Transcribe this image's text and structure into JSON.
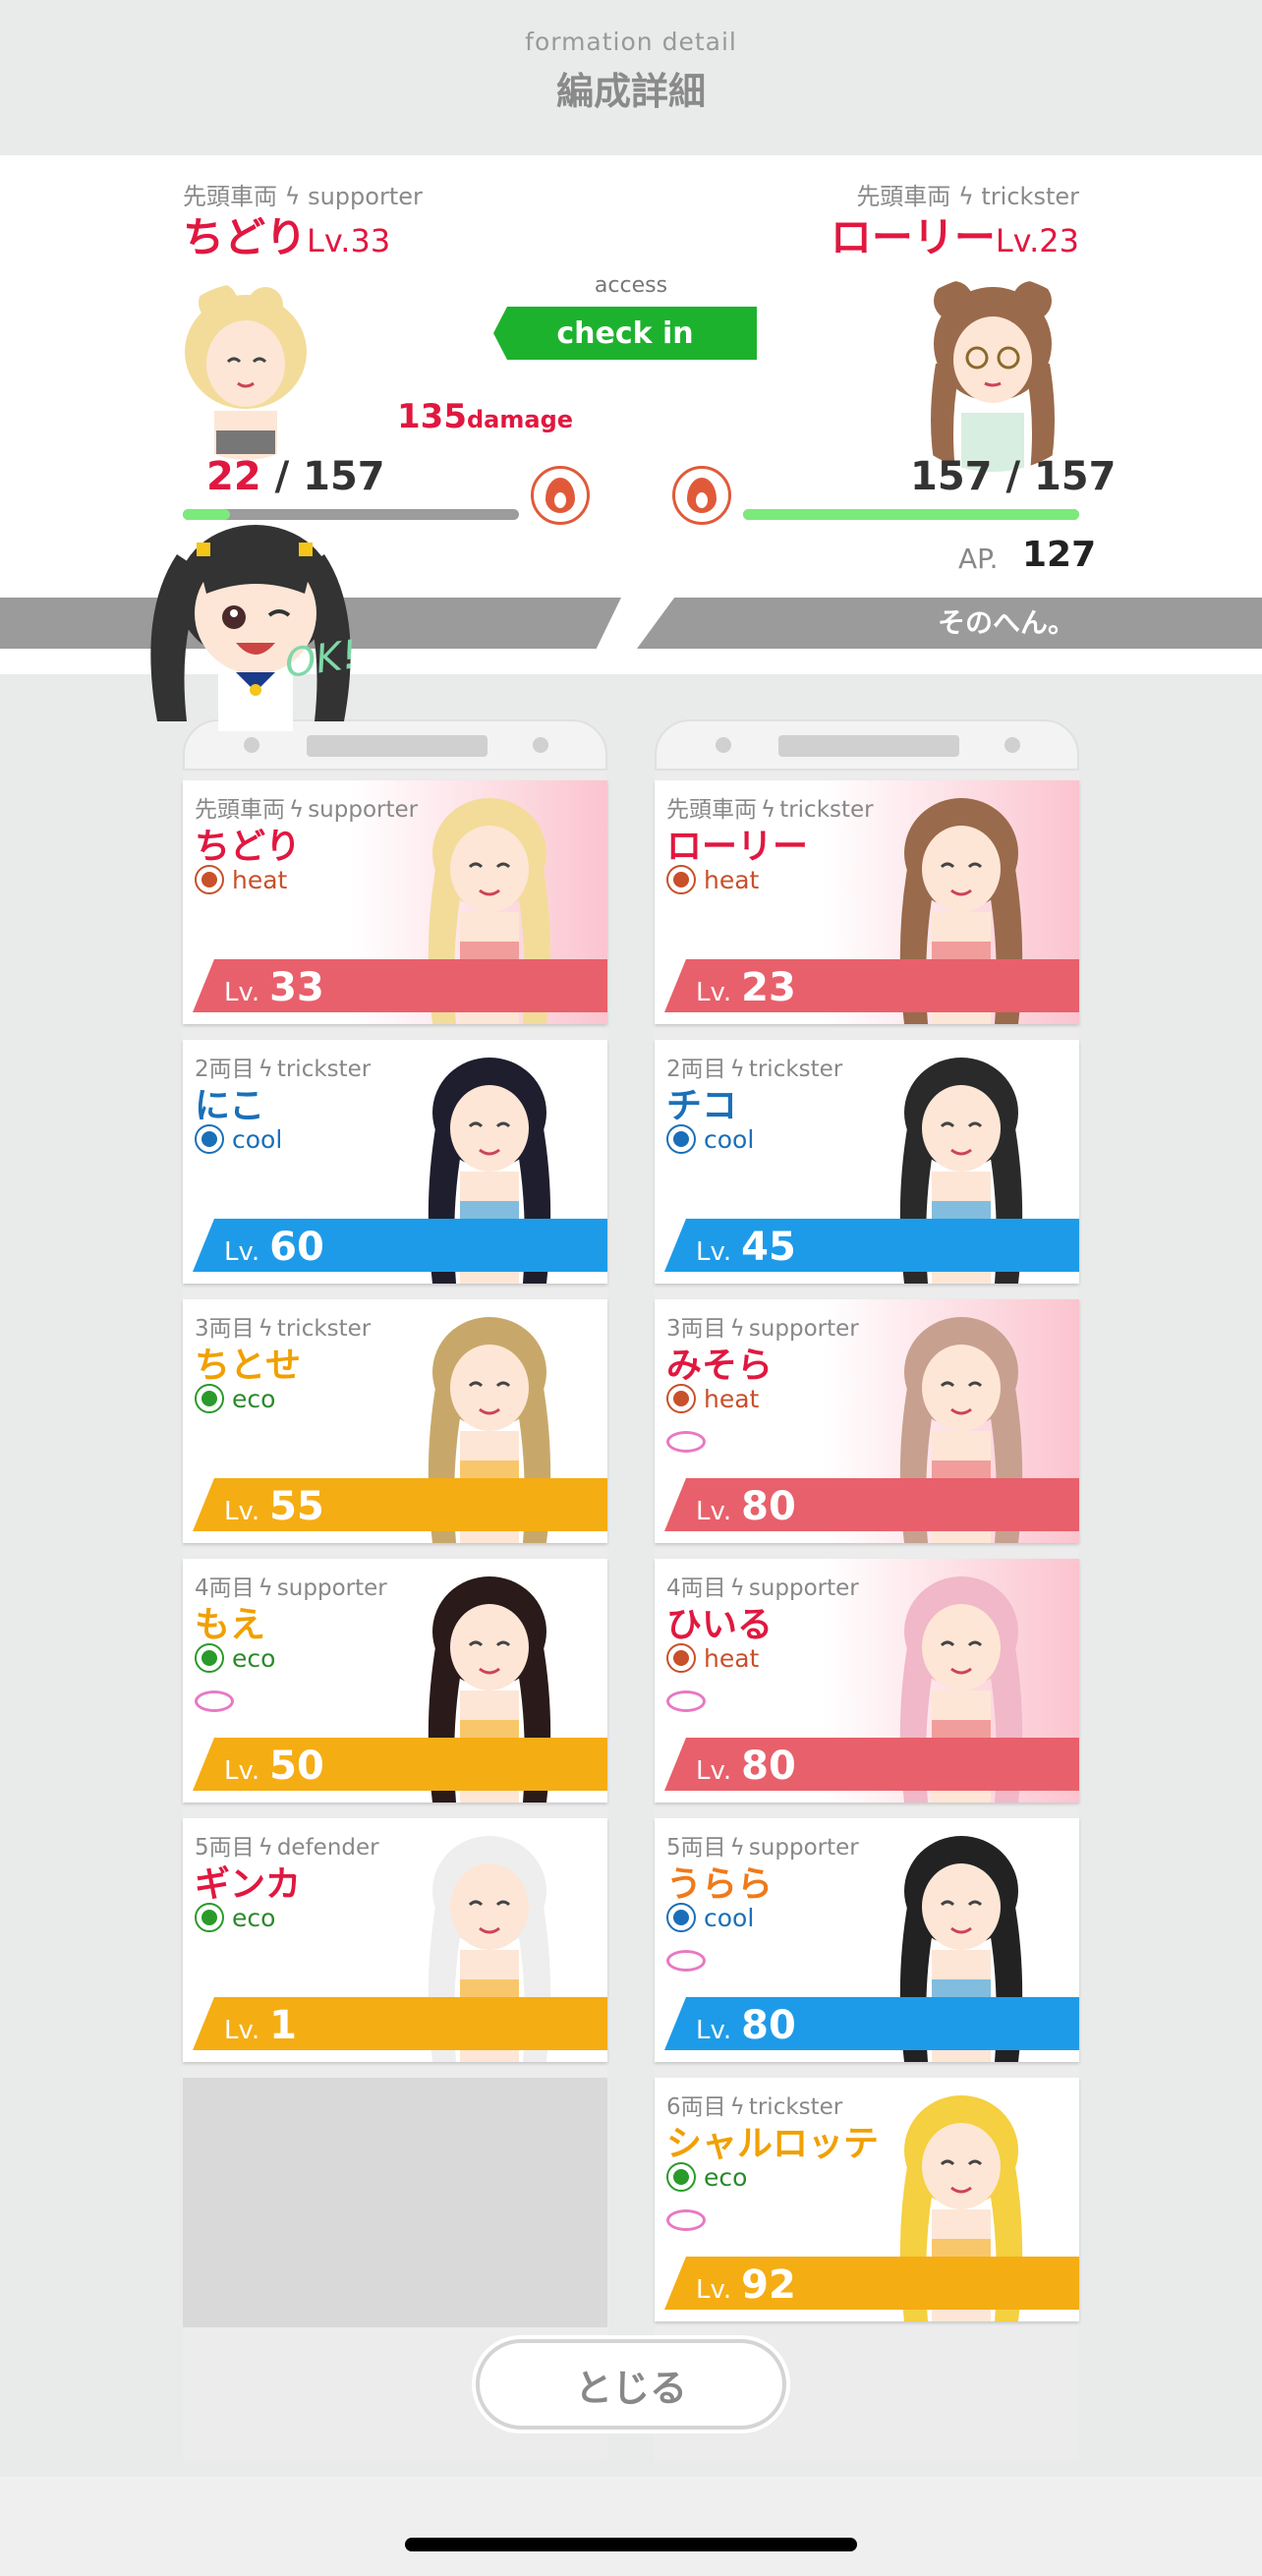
{
  "header": {
    "title_en": "formation detail",
    "title_jp": "編成詳細"
  },
  "battle": {
    "left": {
      "meta": "先頭車両 ϟ supporter",
      "name": "ちどり",
      "level": "Lv.33",
      "hp_current": "22",
      "hp_max": "/ 157",
      "hp_fraction": 0.14
    },
    "right": {
      "meta": "先頭車両 ϟ trickster",
      "name": "ローリー",
      "level": "Lv.23",
      "hp_current": "157",
      "hp_max": "/ 157",
      "hp_fraction": 1.0
    },
    "access_label": "access",
    "checkin_label": "check in",
    "damage_value": "135",
    "damage_unit": "damage",
    "ap_label": "AP.",
    "ap_value": "127",
    "stripe_text": "そのへん。",
    "mascot_text": "OK!"
  },
  "colors": {
    "heat": "#e8606b",
    "cool": "#1e9be8",
    "eco": "#f5ad14",
    "red_name": "#e01840",
    "blue_name": "#1a70b8",
    "yellow_name": "#f0a000",
    "orange_name": "#ef7a1a"
  },
  "left_cards": [
    {
      "pos": "先頭車両",
      "role": "supporter",
      "name": "ちどり",
      "attr": "heat",
      "level": "33",
      "heart": false
    },
    {
      "pos": "2両目",
      "role": "trickster",
      "name": "にこ",
      "attr": "cool",
      "level": "60",
      "heart": false
    },
    {
      "pos": "3両目",
      "role": "trickster",
      "name": "ちとせ",
      "attr": "eco",
      "level": "55",
      "heart": false
    },
    {
      "pos": "4両目",
      "role": "supporter",
      "name": "もえ",
      "attr": "eco",
      "level": "50",
      "heart": true
    },
    {
      "pos": "5両目",
      "role": "defender",
      "name": "ギンカ",
      "attr": "eco",
      "level": "1",
      "heart": false
    }
  ],
  "right_cards": [
    {
      "pos": "先頭車両",
      "role": "trickster",
      "name": "ローリー",
      "attr": "heat",
      "level": "23",
      "heart": false
    },
    {
      "pos": "2両目",
      "role": "trickster",
      "name": "チコ",
      "attr": "cool",
      "level": "45",
      "heart": false
    },
    {
      "pos": "3両目",
      "role": "supporter",
      "name": "みそら",
      "attr": "heat",
      "level": "80",
      "heart": true
    },
    {
      "pos": "4両目",
      "role": "supporter",
      "name": "ひいる",
      "attr": "heat",
      "level": "80",
      "heart": true
    },
    {
      "pos": "5両目",
      "role": "supporter",
      "name": "うらら",
      "attr": "cool",
      "level": "80",
      "heart": true
    },
    {
      "pos": "6両目",
      "role": "trickster",
      "name": "シャルロッテ",
      "attr": "eco",
      "level": "92",
      "heart": true
    }
  ],
  "close_button": "とじる",
  "level_prefix": "Lv."
}
